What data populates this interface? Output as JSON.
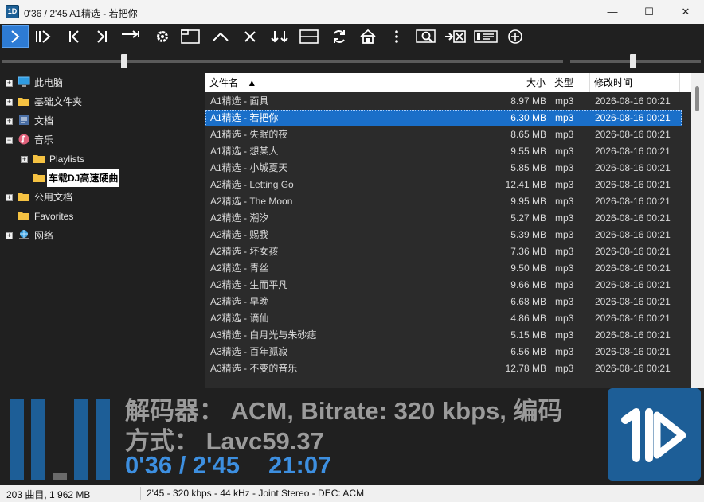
{
  "window": {
    "title": "0'36 / 2'45 A1精选 - 若把你",
    "app_icon_text": "1D",
    "minimize": "—",
    "maximize": "☐",
    "close": "✕"
  },
  "toolbar": {
    "buttons": [
      {
        "name": "play-button",
        "icon": "play-icon",
        "active": true
      },
      {
        "name": "pause-play-button",
        "icon": "pause-play-icon"
      },
      {
        "name": "previous-button",
        "icon": "skip-previous-icon"
      },
      {
        "name": "next-button",
        "icon": "skip-next-icon"
      },
      {
        "name": "stop-after-button",
        "icon": "arrow-right-bar-icon"
      },
      {
        "name": "settings-button",
        "icon": "gear-icon"
      },
      {
        "name": "window-layout-button",
        "icon": "window-layout-icon"
      },
      {
        "name": "collapse-button",
        "icon": "chevron-up-icon"
      },
      {
        "name": "clear-button",
        "icon": "close-icon"
      },
      {
        "name": "sort-button",
        "icon": "sort-down-icon"
      },
      {
        "name": "split-view-button",
        "icon": "split-view-icon"
      },
      {
        "name": "refresh-button",
        "icon": "refresh-icon"
      },
      {
        "name": "home-button",
        "icon": "home-icon"
      },
      {
        "name": "more-button",
        "icon": "more-vertical-icon"
      },
      {
        "name": "search-button",
        "icon": "search-icon"
      },
      {
        "name": "export-button",
        "icon": "export-icon"
      },
      {
        "name": "tag-editor-button",
        "icon": "tag-editor-icon"
      },
      {
        "name": "add-button",
        "icon": "plus-circle-icon"
      }
    ]
  },
  "seek": {
    "position_fraction": 0.218
  },
  "volume": {
    "level_fraction": 0.48
  },
  "tree": {
    "items": [
      {
        "label": "此电脑",
        "icon": "computer-icon",
        "level": 0,
        "expander": "+"
      },
      {
        "label": "基础文件夹",
        "icon": "folder-icon",
        "level": 0,
        "expander": "+"
      },
      {
        "label": "文档",
        "icon": "document-icon",
        "level": 0,
        "expander": "+"
      },
      {
        "label": "音乐",
        "icon": "music-icon",
        "level": 0,
        "expander": "−"
      },
      {
        "label": "Playlists",
        "icon": "folder-icon",
        "level": 1,
        "expander": "+"
      },
      {
        "label": "车载DJ高速硬曲",
        "icon": "folder-icon",
        "level": 1,
        "expander": "",
        "selected": true
      },
      {
        "label": "公用文档",
        "icon": "folder-icon",
        "level": 0,
        "expander": "+"
      },
      {
        "label": "Favorites",
        "icon": "folder-icon",
        "level": 0,
        "expander": ""
      },
      {
        "label": "网络",
        "icon": "network-icon",
        "level": 0,
        "expander": "+"
      }
    ]
  },
  "list": {
    "columns": {
      "name": "文件名",
      "sort_indicator": "▲",
      "size": "大小",
      "type": "类型",
      "date": "修改时间"
    },
    "rows": [
      {
        "name": "A1精选 - 面具",
        "size": "8.97 MB",
        "type": "mp3",
        "date": "2026-08-16 00:21"
      },
      {
        "name": "A1精选 - 若把你",
        "size": "6.30 MB",
        "type": "mp3",
        "date": "2026-08-16 00:21",
        "selected": true
      },
      {
        "name": "A1精选 - 失眠的夜",
        "size": "8.65 MB",
        "type": "mp3",
        "date": "2026-08-16 00:21"
      },
      {
        "name": "A1精选 - 想某人",
        "size": "9.55 MB",
        "type": "mp3",
        "date": "2026-08-16 00:21"
      },
      {
        "name": "A1精选 - 小城夏天",
        "size": "5.85 MB",
        "type": "mp3",
        "date": "2026-08-16 00:21"
      },
      {
        "name": "A2精选 - Letting Go",
        "size": "12.41 MB",
        "type": "mp3",
        "date": "2026-08-16 00:21"
      },
      {
        "name": "A2精选 - The Moon",
        "size": "9.95 MB",
        "type": "mp3",
        "date": "2026-08-16 00:21"
      },
      {
        "name": "A2精选 - 潮汐",
        "size": "5.27 MB",
        "type": "mp3",
        "date": "2026-08-16 00:21"
      },
      {
        "name": "A2精选 - 赐我",
        "size": "5.39 MB",
        "type": "mp3",
        "date": "2026-08-16 00:21"
      },
      {
        "name": "A2精选 - 坏女孩",
        "size": "7.36 MB",
        "type": "mp3",
        "date": "2026-08-16 00:21"
      },
      {
        "name": "A2精选 - 青丝",
        "size": "9.50 MB",
        "type": "mp3",
        "date": "2026-08-16 00:21"
      },
      {
        "name": "A2精选 - 生而平凡",
        "size": "9.66 MB",
        "type": "mp3",
        "date": "2026-08-16 00:21"
      },
      {
        "name": "A2精选 - 早晚",
        "size": "6.68 MB",
        "type": "mp3",
        "date": "2026-08-16 00:21"
      },
      {
        "name": "A2精选 - 谪仙",
        "size": "4.86 MB",
        "type": "mp3",
        "date": "2026-08-16 00:21"
      },
      {
        "name": "A3精选 - 白月光与朱砂痣",
        "size": "5.15 MB",
        "type": "mp3",
        "date": "2026-08-16 00:21"
      },
      {
        "name": "A3精选 - 百年孤寂",
        "size": "6.56 MB",
        "type": "mp3",
        "date": "2026-08-16 00:21"
      },
      {
        "name": "A3精选 - 不变的音乐",
        "size": "12.78 MB",
        "type": "mp3",
        "date": "2026-08-16 00:21"
      }
    ]
  },
  "info": {
    "line1": "解码器： ACM, Bitrate: 320 kbps, 编码",
    "line2": "方式： Lavc59.37",
    "time": "0'36 / 2'45",
    "clock": "21:07",
    "vu_levels": [
      1.0,
      1.0,
      0.09,
      1.0,
      1.0
    ]
  },
  "status": {
    "count": "203 曲目, 1 962 MB",
    "details": "2'45 - 320 kbps - 44 kHz - Joint Stereo - DEC: ACM"
  },
  "colors": {
    "accent": "#1d5e97",
    "selection": "#1a6fc9",
    "time_text": "#3d8fe0"
  }
}
